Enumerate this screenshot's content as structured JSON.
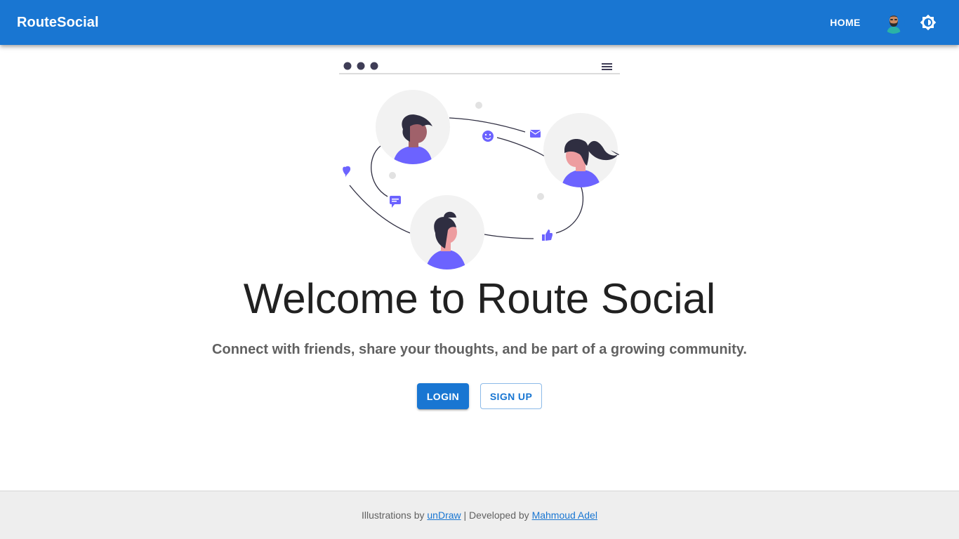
{
  "appbar": {
    "brand": "RouteSocial",
    "home_label": "HOME",
    "color": "#1976d2"
  },
  "icons": {
    "avatar": "user-avatar",
    "theme_toggle": "brightness-icon",
    "illustration": "connected-people-illustration"
  },
  "hero": {
    "title": "Welcome to Route Social",
    "tagline": "Connect with friends, share your thoughts, and be part of a growing community.",
    "login_label": "LOGIN",
    "signup_label": "SIGN UP"
  },
  "footer": {
    "prefix": "Illustrations by ",
    "undraw_link": "unDraw",
    "separator": " | Developed by ",
    "author_link": "Mahmoud Adel"
  },
  "colors": {
    "primary": "#1976d2",
    "accent_purple": "#6c63ff",
    "footer_bg": "#eeeeee"
  }
}
